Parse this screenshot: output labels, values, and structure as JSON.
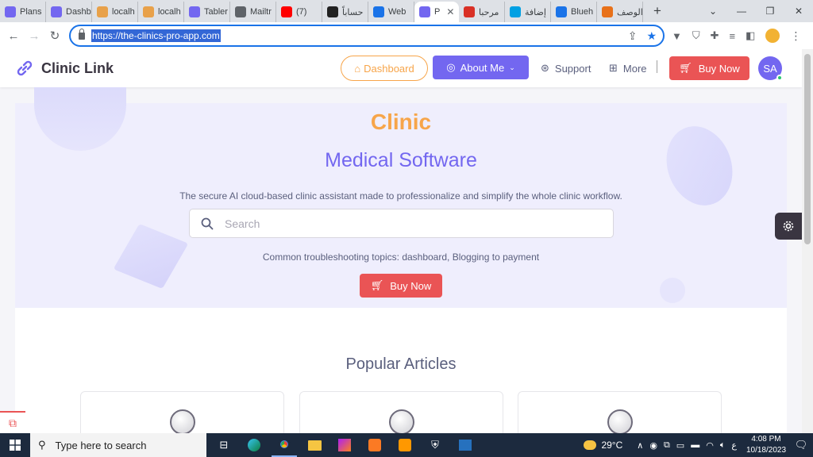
{
  "browser": {
    "tabs": [
      {
        "label": "Plans",
        "color": "#7367f0"
      },
      {
        "label": "Dashb",
        "color": "#7367f0"
      },
      {
        "label": "localh",
        "color": "#e8a14a"
      },
      {
        "label": "localh",
        "color": "#e8a14a"
      },
      {
        "label": "Tabler",
        "color": "#7367f0"
      },
      {
        "label": "Mailtr",
        "color": "#5f6368"
      },
      {
        "label": "(7)",
        "color": "#ff0000"
      },
      {
        "label": "حساباً",
        "color": "#222222"
      },
      {
        "label": "Web",
        "color": "#1a73e8"
      },
      {
        "label": "P",
        "color": "#7367f0",
        "active": true
      },
      {
        "label": "مرحبا",
        "color": "#d93025"
      },
      {
        "label": "إضافة",
        "color": "#00a0e3"
      },
      {
        "label": "Blueh",
        "color": "#1a73e8"
      },
      {
        "label": "الوصف",
        "color": "#e8711a"
      }
    ],
    "new_tab_label": "+",
    "url": "https://the-clinics-pro-app.com"
  },
  "site": {
    "brand": "Clinic Link",
    "nav": {
      "dashboard": "Dashboard",
      "about": "About Me",
      "support": "Support",
      "more": "More",
      "buy": "Buy Now"
    },
    "avatar_initials": "SA"
  },
  "hero": {
    "title": "Clinic",
    "subtitle": "Medical Software",
    "description": "The secure AI cloud-based clinic assistant made to professionalize and simplify the whole clinic workflow.",
    "search_placeholder": "Search",
    "topics": "Common troubleshooting topics: dashboard, Blogging to payment",
    "buy": "Buy Now"
  },
  "articles": {
    "heading": "Popular Articles"
  },
  "taskbar": {
    "search_placeholder": "Type here to search",
    "temperature": "29°C",
    "lang": "ع",
    "time": "4:08 PM",
    "date": "10/18/2023"
  },
  "colors": {
    "primary": "#7367f0",
    "warning": "#f7a54a",
    "danger": "#ea5455",
    "success": "#28c76f"
  }
}
